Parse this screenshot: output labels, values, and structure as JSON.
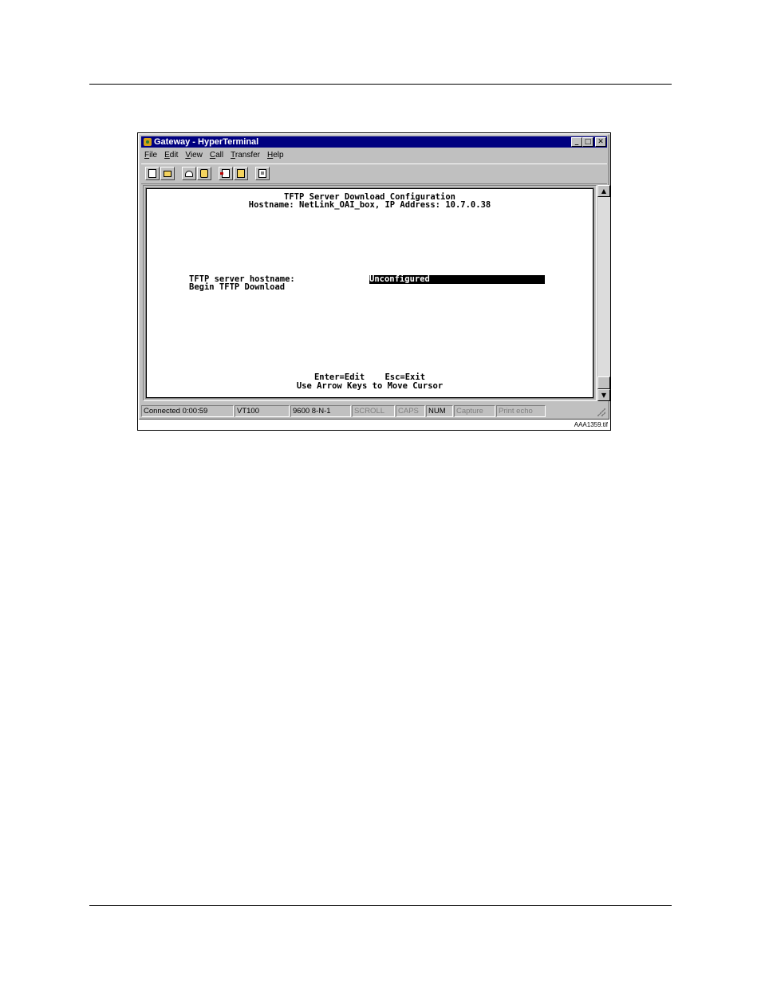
{
  "window": {
    "title": "Gateway - HyperTerminal"
  },
  "menu": [
    {
      "accel": "F",
      "rest": "ile"
    },
    {
      "accel": "E",
      "rest": "dit"
    },
    {
      "accel": "V",
      "rest": "iew"
    },
    {
      "accel": "C",
      "rest": "all"
    },
    {
      "accel": "T",
      "rest": "ransfer"
    },
    {
      "accel": "H",
      "rest": "elp"
    }
  ],
  "toolbar": {
    "icons": [
      "new-document-icon",
      "open-folder-icon",
      "connect-phone-icon",
      "disconnect-icon",
      "send-file-icon",
      "receive-file-icon",
      "properties-icon"
    ]
  },
  "terminal": {
    "heading": "TFTP Server Download Configuration",
    "subheading": "Hostname: NetLink_OAI_box, IP Address: 10.7.0.38",
    "field_label": "TFTP server hostname:",
    "field_value": "Unconfigured",
    "action_label": "Begin TFTP Download",
    "help_line1": "Enter=Edit    Esc=Exit",
    "help_line2": "Use Arrow Keys to Move Cursor"
  },
  "status": {
    "connected": "Connected 0:00:59",
    "emulation": "VT100",
    "port_settings": "9600 8-N-1",
    "scroll": "SCROLL",
    "caps": "CAPS",
    "num": "NUM",
    "capture": "Capture",
    "print_echo": "Print echo"
  },
  "figure_caption": "AAA1359.tif"
}
